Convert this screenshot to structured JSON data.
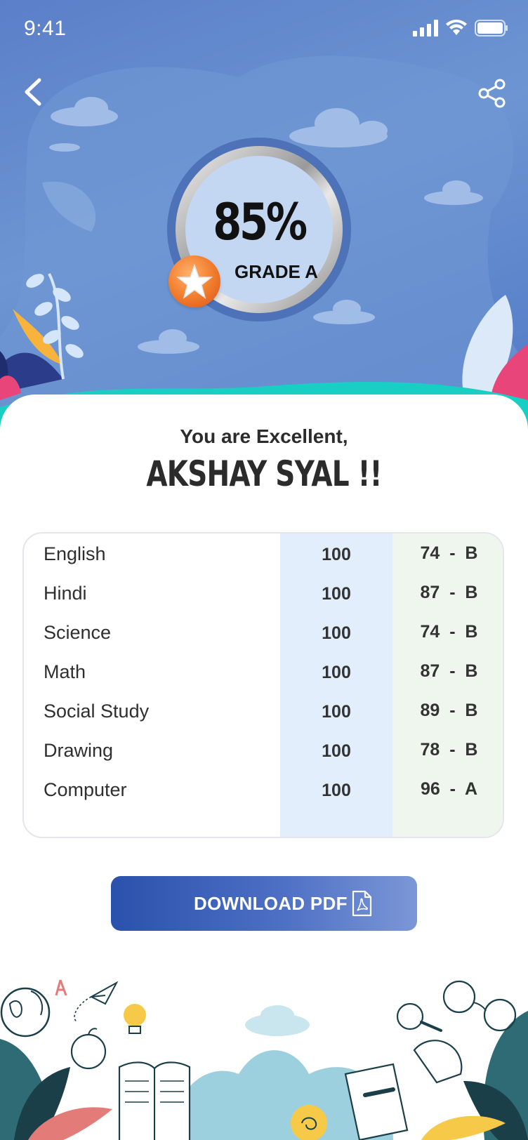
{
  "status_bar": {
    "time": "9:41"
  },
  "header": {
    "back_icon": "chevron-left-icon",
    "share_icon": "share-icon"
  },
  "result": {
    "percentage": "85%",
    "grade": "GRADE A",
    "badge_icon": "star-icon"
  },
  "greeting": {
    "line": "You are Excellent,",
    "name": "AKSHAY SYAL !!"
  },
  "marks": {
    "rows": [
      {
        "subject": "English",
        "total": "100",
        "score": "74  -  B"
      },
      {
        "subject": "Hindi",
        "total": "100",
        "score": "87  -  B"
      },
      {
        "subject": "Science",
        "total": "100",
        "score": "74  -  B"
      },
      {
        "subject": "Math",
        "total": "100",
        "score": "87  -  B"
      },
      {
        "subject": "Social Study",
        "total": "100",
        "score": "89  -  B"
      },
      {
        "subject": "Drawing",
        "total": "100",
        "score": "78  -  B"
      },
      {
        "subject": "Computer",
        "total": "100",
        "score": "96  -  A"
      }
    ]
  },
  "actions": {
    "download_label": "DOWNLOAD PDF",
    "download_icon": "pdf-file-icon"
  },
  "colors": {
    "hero_bg": "#5b7fc9",
    "teal_wave": "#19cfc4",
    "button_start": "#2a51ac",
    "button_end": "#7b97d6",
    "total_column": "#e3eefd",
    "score_column": "#eef6ee"
  }
}
